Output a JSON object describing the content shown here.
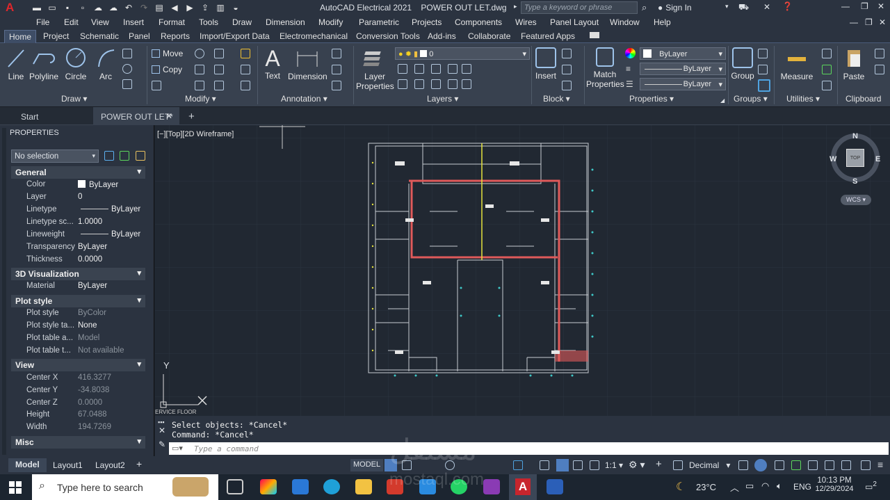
{
  "app": {
    "title": "AutoCAD Electrical 2021",
    "file": "POWER OUT LET.dwg",
    "search_placeholder": "Type a keyword or phrase",
    "sign_in": "Sign In"
  },
  "menu": [
    "File",
    "Edit",
    "View",
    "Insert",
    "Format",
    "Tools",
    "Draw",
    "Dimension",
    "Modify",
    "Parametric",
    "Projects",
    "Components",
    "Wires",
    "Panel Layout",
    "Window",
    "Help"
  ],
  "ribbon_tabs": [
    "Home",
    "Project",
    "Schematic",
    "Panel",
    "Reports",
    "Import/Export Data",
    "Electromechanical",
    "Conversion Tools",
    "Add-ins",
    "Collaborate",
    "Featured Apps"
  ],
  "ribbon": {
    "draw": {
      "line": "Line",
      "polyline": "Polyline",
      "circle": "Circle",
      "arc": "Arc",
      "title": "Draw"
    },
    "modify": {
      "move": "Move",
      "copy": "Copy",
      "title": "Modify"
    },
    "annotation": {
      "text": "Text",
      "dimension": "Dimension",
      "title": "Annotation"
    },
    "layers": {
      "props_l1": "Layer",
      "props_l2": "Properties",
      "current": "0",
      "title": "Layers"
    },
    "block": {
      "insert": "Insert",
      "title": "Block"
    },
    "properties": {
      "match_l1": "Match",
      "match_l2": "Properties",
      "color": "ByLayer",
      "lineweight": "ByLayer",
      "linetype": "ByLayer",
      "title": "Properties"
    },
    "groups": {
      "group": "Group",
      "title": "Groups"
    },
    "utilities": {
      "measure": "Measure",
      "title": "Utilities"
    },
    "clipboard": {
      "paste": "Paste",
      "title": "Clipboard"
    }
  },
  "doc_tabs": {
    "start": "Start",
    "active": "POWER OUT LET*",
    "add": "+"
  },
  "properties": {
    "title": "PROPERTIES",
    "selection": "No selection",
    "general": {
      "title": "General",
      "rows": [
        [
          "Color",
          "ByLayer"
        ],
        [
          "Layer",
          "0"
        ],
        [
          "Linetype",
          "ByLayer"
        ],
        [
          "Linetype sc...",
          "1.0000"
        ],
        [
          "Lineweight",
          "ByLayer"
        ],
        [
          "Transparency",
          "ByLayer"
        ],
        [
          "Thickness",
          "0.0000"
        ]
      ]
    },
    "viz": {
      "title": "3D Visualization",
      "rows": [
        [
          "Material",
          "ByLayer"
        ]
      ]
    },
    "plot": {
      "title": "Plot style",
      "rows": [
        [
          "Plot style",
          "ByColor"
        ],
        [
          "Plot style ta...",
          "None"
        ],
        [
          "Plot table a...",
          "Model"
        ],
        [
          "Plot table t...",
          "Not available"
        ]
      ]
    },
    "view": {
      "title": "View",
      "rows": [
        [
          "Center X",
          "416.3277"
        ],
        [
          "Center Y",
          "-34.8038"
        ],
        [
          "Center Z",
          "0.0000"
        ],
        [
          "Height",
          "67.0488"
        ],
        [
          "Width",
          "194.7269"
        ]
      ]
    },
    "misc": {
      "title": "Misc"
    }
  },
  "viewport": {
    "label": "[−][Top][2D Wireframe]",
    "floor_label": "ERVICE FLOOR",
    "compass": {
      "n": "N",
      "s": "S",
      "e": "E",
      "w": "W",
      "top": "TOP",
      "wcs": "WCS"
    },
    "ucs_y": "Y"
  },
  "command": {
    "line1": "Select objects: *Cancel*",
    "line2": "Command: *Cancel*",
    "placeholder": "Type a command"
  },
  "layout_tabs": [
    "Model",
    "Layout1",
    "Layout2",
    "+"
  ],
  "status": {
    "model": "MODEL",
    "scale": "1:1",
    "units": "Decimal"
  },
  "taskbar": {
    "search": "Type here to search",
    "temp": "23°C",
    "lang": "ENG",
    "time": "10:13 PM",
    "date": "12/29/2024",
    "notif": "2"
  },
  "watermark": {
    "arabic": "مستقل",
    "latin": "mostaql.com"
  }
}
